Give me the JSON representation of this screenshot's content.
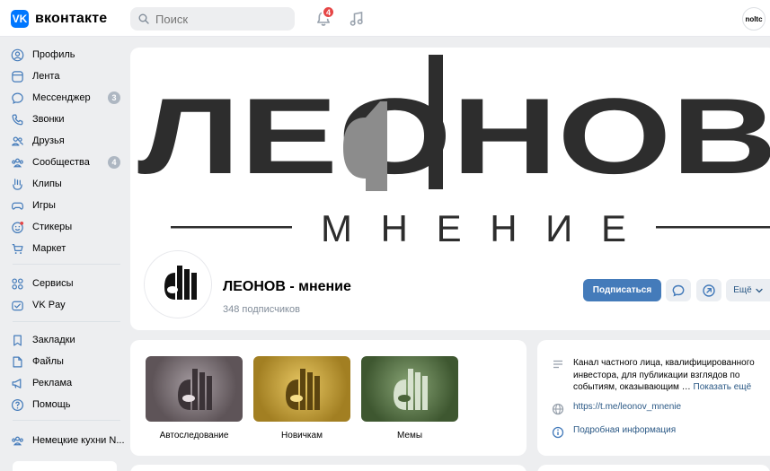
{
  "header": {
    "logo_text": "вконтакте",
    "logo_mark": "VK",
    "search_placeholder": "Поиск",
    "notifications_count": "4",
    "profile_avatar_text": "noltc"
  },
  "sidebar": {
    "items": [
      {
        "label": "Профиль",
        "icon": "user-icon"
      },
      {
        "label": "Лента",
        "icon": "feed-icon"
      },
      {
        "label": "Мессенджер",
        "icon": "message-icon",
        "count": "3"
      },
      {
        "label": "Звонки",
        "icon": "phone-icon"
      },
      {
        "label": "Друзья",
        "icon": "friends-icon"
      },
      {
        "label": "Сообщества",
        "icon": "communities-icon",
        "count": "4"
      },
      {
        "label": "Клипы",
        "icon": "clips-icon"
      },
      {
        "label": "Игры",
        "icon": "games-icon"
      },
      {
        "label": "Стикеры",
        "icon": "stickers-icon"
      },
      {
        "label": "Маркет",
        "icon": "market-icon"
      }
    ],
    "items2": [
      {
        "label": "Сервисы",
        "icon": "services-icon"
      },
      {
        "label": "VK Pay",
        "icon": "vkpay-icon"
      }
    ],
    "items3": [
      {
        "label": "Закладки",
        "icon": "bookmark-icon"
      },
      {
        "label": "Файлы",
        "icon": "files-icon"
      },
      {
        "label": "Реклама",
        "icon": "ads-icon"
      },
      {
        "label": "Помощь",
        "icon": "help-icon"
      }
    ],
    "items4": [
      {
        "label": "Немецкие кухни N...",
        "icon": "group-icon"
      }
    ]
  },
  "cover": {
    "title": "ЛЕОНОВ",
    "subtitle": "МНЕНИЕ"
  },
  "group": {
    "name": "ЛЕОНОВ - мнение",
    "subscribers": "348 подписчиков",
    "subscribe_label": "Подписаться",
    "more_label": "Ещё"
  },
  "albums": [
    {
      "label": "Автоследование",
      "color": "#6b5f66"
    },
    {
      "label": "Новичкам",
      "color": "#c8a43a"
    },
    {
      "label": "Мемы",
      "color": "#55703f"
    }
  ],
  "info": {
    "description": "Канал частного лица, квалифицированного инвестора, для публикации взглядов по событиям, оказывающим … ",
    "show_more": "Показать ещё",
    "link": "https://t.me/leonov_mnenie",
    "details": "Подробная информация"
  },
  "colors": {
    "accent": "#447bba",
    "link": "#2a5885",
    "brand": "#0077ff",
    "notification": "#e64646"
  }
}
